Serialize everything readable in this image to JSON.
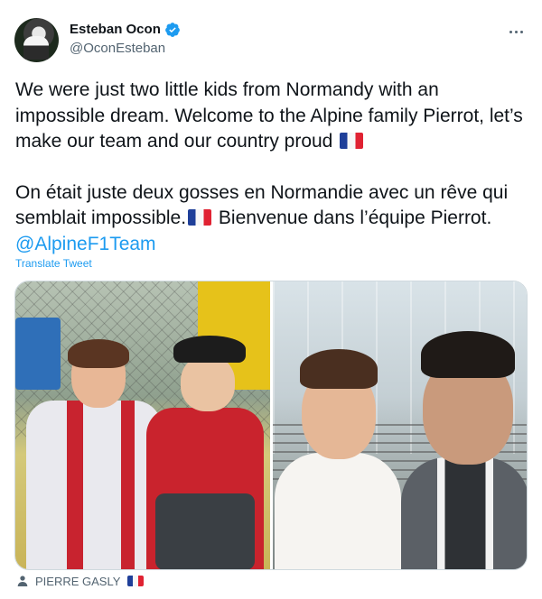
{
  "author": {
    "display_name": "Esteban Ocon",
    "handle": "@OconEsteban",
    "verified": true
  },
  "tweet": {
    "text_en": "We were just two little kids from Normandy with an impossible dream. Welcome to the Alpine family Pierrot, let’s make our team and our country proud",
    "text_fr_before": "On était juste deux gosses en Normandie avec un rêve qui semblait impossible.",
    "text_fr_after": " Bienvenue dans l’équipe Pierrot. ",
    "mention": "@AlpineF1Team",
    "flag_icon": "france-flag-icon"
  },
  "translate_label": "Translate Tweet",
  "media": {
    "photos": [
      "childhood-photo",
      "selfie-photo"
    ]
  },
  "tagged_user": {
    "name": "PIERRE GASLY",
    "icon": "person-icon"
  },
  "colors": {
    "link": "#1d9bf0",
    "secondary_text": "#536471",
    "primary_text": "#0f1419"
  }
}
